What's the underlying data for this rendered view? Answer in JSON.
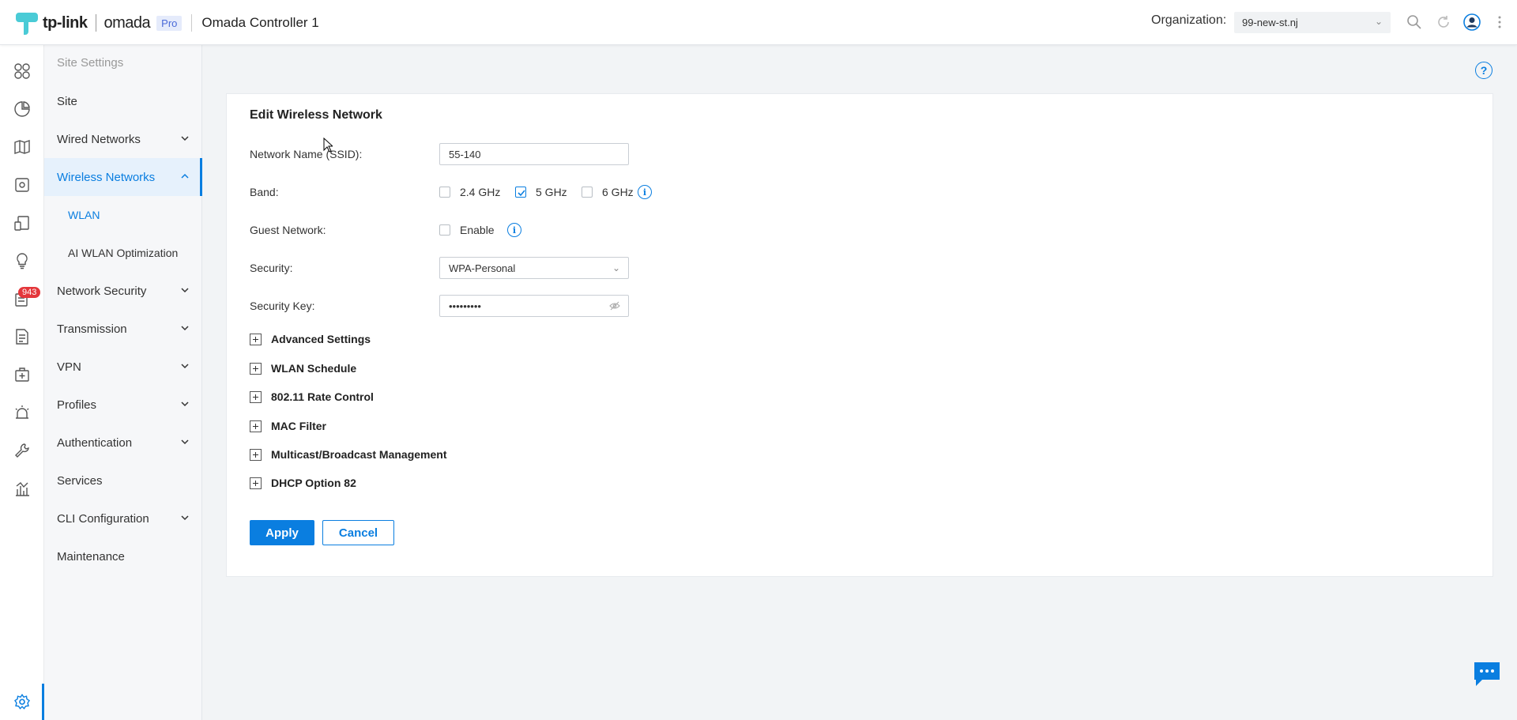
{
  "header": {
    "brand": "tp-link",
    "product": "omada",
    "edition": "Pro",
    "controller": "Omada Controller 1",
    "org_label": "Organization:",
    "org_value": "99-new-st.nj",
    "icons": [
      "search-icon",
      "refresh-icon",
      "user-avatar-icon",
      "more-icon"
    ]
  },
  "rail": {
    "items": [
      "dashboard-icon",
      "statistics-icon",
      "map-icon",
      "devices-icon",
      "clients-icon",
      "insights-icon",
      "logs-icon",
      "reports-icon",
      "hotspot-icon",
      "alerts-icon",
      "tools-icon",
      "analytics-icon"
    ],
    "badge": "943",
    "settings": "settings-icon"
  },
  "nav": {
    "header": "Site Settings",
    "site": "Site",
    "wired": "Wired Networks",
    "wireless": "Wireless Networks",
    "wlan": "WLAN",
    "ai_wlan": "AI WLAN Optimization",
    "network_security": "Network Security",
    "transmission": "Transmission",
    "vpn": "VPN",
    "profiles": "Profiles",
    "authentication": "Authentication",
    "services": "Services",
    "cli": "CLI Configuration",
    "maintenance": "Maintenance"
  },
  "form": {
    "title": "Edit Wireless Network",
    "ssid_label": "Network Name (SSID):",
    "ssid_value": "55-140",
    "band_label": "Band:",
    "band_24": "2.4 GHz",
    "band_5": "5 GHz",
    "band_6": "6 GHz",
    "band_24_checked": false,
    "band_5_checked": true,
    "band_6_checked": false,
    "guest_label": "Guest Network:",
    "guest_enable": "Enable",
    "guest_checked": false,
    "security_label": "Security:",
    "security_value": "WPA-Personal",
    "key_label": "Security Key:",
    "key_value": "•••••••••",
    "sections": {
      "advanced": "Advanced Settings",
      "schedule": "WLAN Schedule",
      "rate": "802.11 Rate Control",
      "mac": "MAC Filter",
      "multicast": "Multicast/Broadcast Management",
      "dhcp": "DHCP Option 82"
    },
    "apply": "Apply",
    "cancel": "Cancel"
  },
  "colors": {
    "accent": "#0a7ee0",
    "badge": "#e4373b"
  }
}
